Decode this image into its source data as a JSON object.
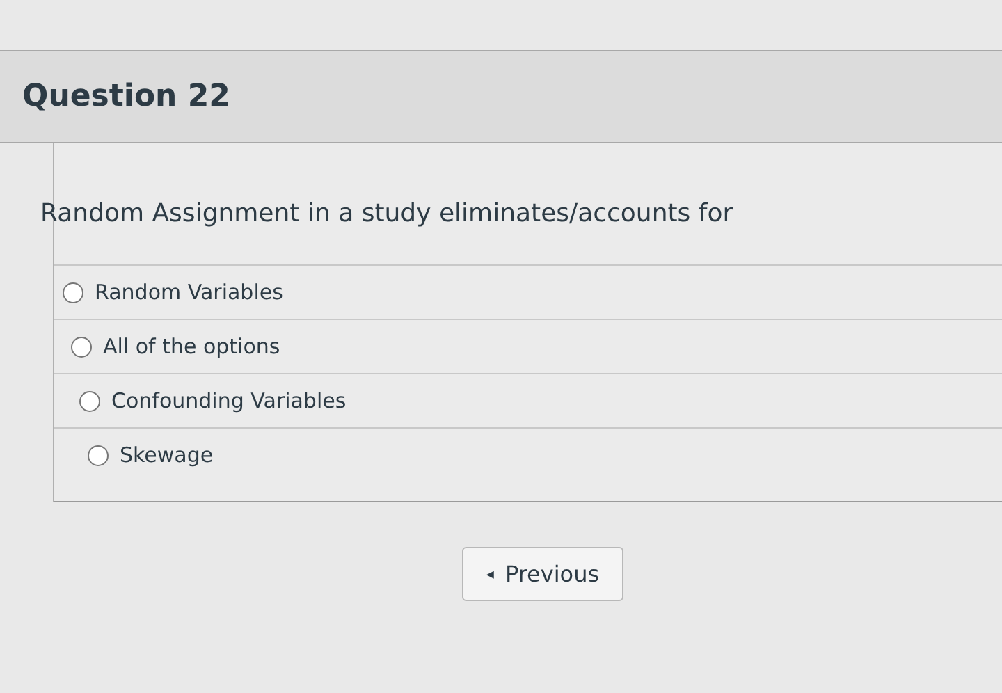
{
  "question": {
    "title": "Question 22",
    "text": "Random Assignment in a study eliminates/accounts for",
    "options": [
      {
        "label": "Random Variables",
        "selected": false
      },
      {
        "label": "All of the options",
        "selected": false
      },
      {
        "label": "Confounding Variables",
        "selected": false
      },
      {
        "label": "Skewage",
        "selected": false
      }
    ]
  },
  "navigation": {
    "previous": "Previous",
    "arrow": "◂"
  }
}
